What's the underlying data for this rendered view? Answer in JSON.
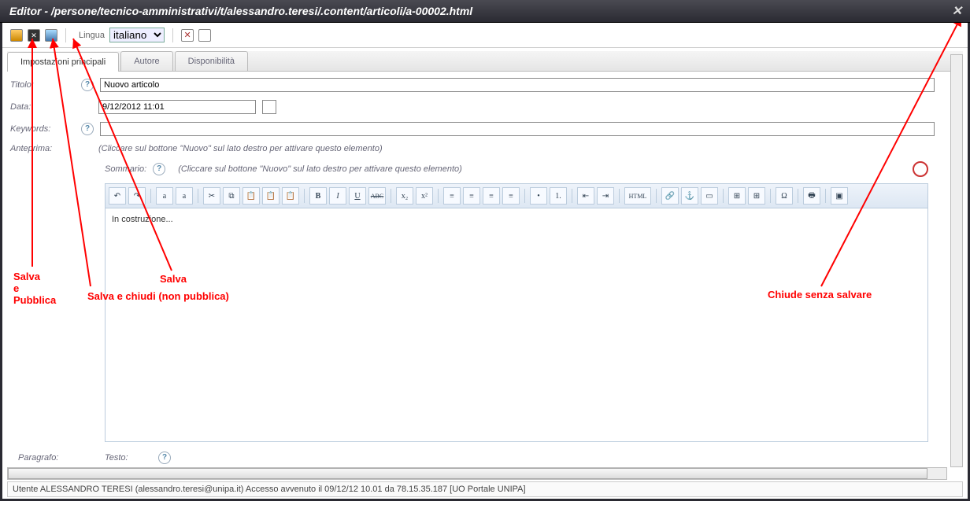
{
  "title": "Editor  -  /persone/tecnico-amministrativi/t/alessandro.teresi/.content/articoli/a-00002.html",
  "toolbar": {
    "lang_label": "Lingua",
    "lang_value": "italiano"
  },
  "tabs": {
    "t1": "Impostazioni principali",
    "t2": "Autore",
    "t3": "Disponibilità"
  },
  "form": {
    "titolo_label": "Titolo:",
    "titolo_value": "Nuovo articolo",
    "data_label": "Data:",
    "data_value": "9/12/2012 11:01",
    "keywords_label": "Keywords:",
    "keywords_value": "",
    "anteprima_label": "Anteprima:",
    "anteprima_hint": "(Cliccare sul bottone \"Nuovo\" sul lato destro per attivare questo elemento)",
    "sommario_label": "Sommario:",
    "sommario_hint": "(Cliccare sul bottone \"Nuovo\" sul lato destro per attivare questo elemento)",
    "testo_body": "In costruzione...",
    "paragrafo_label": "Paragrafo:",
    "testo_label": "Testo:"
  },
  "rt": {
    "undo": "↶",
    "redo": "↷",
    "a1": "a",
    "a2": "a",
    "cut": "✂",
    "copy": "⧉",
    "paste": "📋",
    "p2": "📋",
    "p3": "📋",
    "bold": "B",
    "italic": "I",
    "under": "U",
    "strike": "ABC",
    "sub": "x₂",
    "sup": "x²",
    "al": "≡",
    "ac": "≡",
    "ar": "≡",
    "aj": "≡",
    "ul": "•",
    "ol": "1.",
    "out": "⇤",
    "in": "⇥",
    "html": "HTML",
    "link": "🔗",
    "anchor": "⚓",
    "img": "▭",
    "t1": "⊞",
    "t2": "⊞",
    "omega": "Ω",
    "pr": "🖶",
    "max": "▣"
  },
  "annotations": {
    "salva_pubblica": "Salva\ne\nPubblica",
    "salva_chiudi": "Salva e chiudi (non pubblica)",
    "salva": "Salva",
    "chiude": "Chiude senza salvare"
  },
  "status": "Utente ALESSANDRO TERESI (alessandro.teresi@unipa.it) Accesso avvenuto il 09/12/12 10.01 da 78.15.35.187 [UO Portale UNIPA]"
}
